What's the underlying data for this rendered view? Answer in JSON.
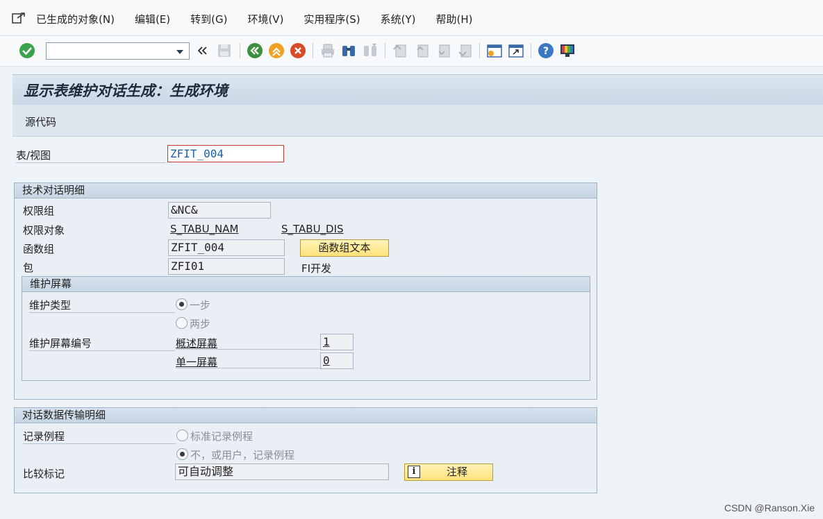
{
  "menu": {
    "items": [
      "已生成的对象(N)",
      "编辑(E)",
      "转到(G)",
      "环境(V)",
      "实用程序(S)",
      "系统(Y)",
      "帮助(H)"
    ]
  },
  "toolbar": {
    "command_field_value": "",
    "icons": [
      "enter-icon",
      "back-icon",
      "exit-icon",
      "cancel-icon",
      "save-icon",
      "print-icon",
      "find-icon",
      "find-next-icon",
      "first-page-icon",
      "prev-page-icon",
      "next-page-icon",
      "last-page-icon",
      "create-session-icon",
      "shortcut-icon",
      "help-icon",
      "customize-layout-icon"
    ]
  },
  "title": "显示表维护对话生成：生成环境",
  "app_toolbar": {
    "source_code": "源代码"
  },
  "table_view": {
    "label": "表/视图",
    "value": "ZFIT_004"
  },
  "tech_details": {
    "header": "技术对话明细",
    "auth_group_label": "权限组",
    "auth_group_value": "&NC&",
    "auth_object_label": "权限对象",
    "auth_object_1": "S_TABU_NAM",
    "auth_object_2": "S_TABU_DIS",
    "func_group_label": "函数组",
    "func_group_value": "ZFIT_004",
    "func_group_text_button": "函数组文本",
    "package_label": "包",
    "package_value": "ZFI01",
    "package_desc": "FI开发"
  },
  "maint_screen": {
    "header": "维护屏幕",
    "type_label": "维护类型",
    "one_step": "一步",
    "two_step": "两步",
    "one_step_selected": true,
    "screen_no_label": "维护屏幕编号",
    "overview_label": "概述屏幕",
    "overview_value": "1",
    "single_label": "单一屏幕",
    "single_value": "0"
  },
  "transport": {
    "header": "对话数据传输明细",
    "routine_label": "记录例程",
    "standard_routine": "标准记录例程",
    "no_routine": "不，或用户，记录例程",
    "no_routine_selected": true,
    "compare_label": "比较标记",
    "compare_value": "可自动调整",
    "comment_button": "注释"
  },
  "watermark": "CSDN @Ranson.Xie",
  "colors": {
    "accent": "#1f5fa8",
    "button": "#ffe27a"
  }
}
